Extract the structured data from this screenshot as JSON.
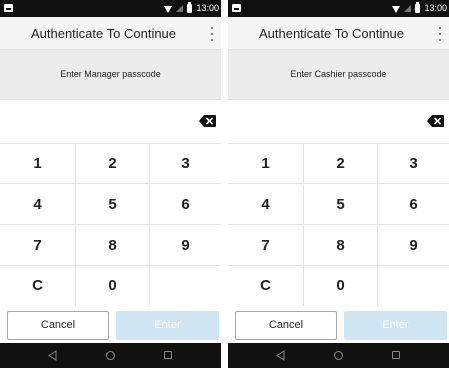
{
  "status_bar": {
    "time": "13:00"
  },
  "app_bar": {
    "title": "Authenticate To Continue",
    "menu_icon": "kebab-menu-icon"
  },
  "screens": [
    {
      "prompt": "Enter Manager passcode",
      "keys": [
        "1",
        "2",
        "3",
        "4",
        "5",
        "6",
        "7",
        "8",
        "9",
        "C",
        "0"
      ],
      "cancel_label": "Cancel",
      "enter_label": "Enter"
    },
    {
      "prompt": "Enter Cashier passcode",
      "keys": [
        "1",
        "2",
        "3",
        "4",
        "5",
        "6",
        "7",
        "8",
        "9",
        "C",
        "0"
      ],
      "cancel_label": "Cancel",
      "enter_label": "Enter"
    }
  ],
  "icons": {
    "backspace": "backspace-icon",
    "nav_back": "back-triangle-icon",
    "nav_home": "home-circle-icon",
    "nav_recents": "recents-square-icon"
  },
  "colors": {
    "enter_disabled": "#cfe6f2",
    "app_bar_bg": "#f5f5f5",
    "prompt_bg": "#ececec",
    "system_bar": "#111111"
  }
}
